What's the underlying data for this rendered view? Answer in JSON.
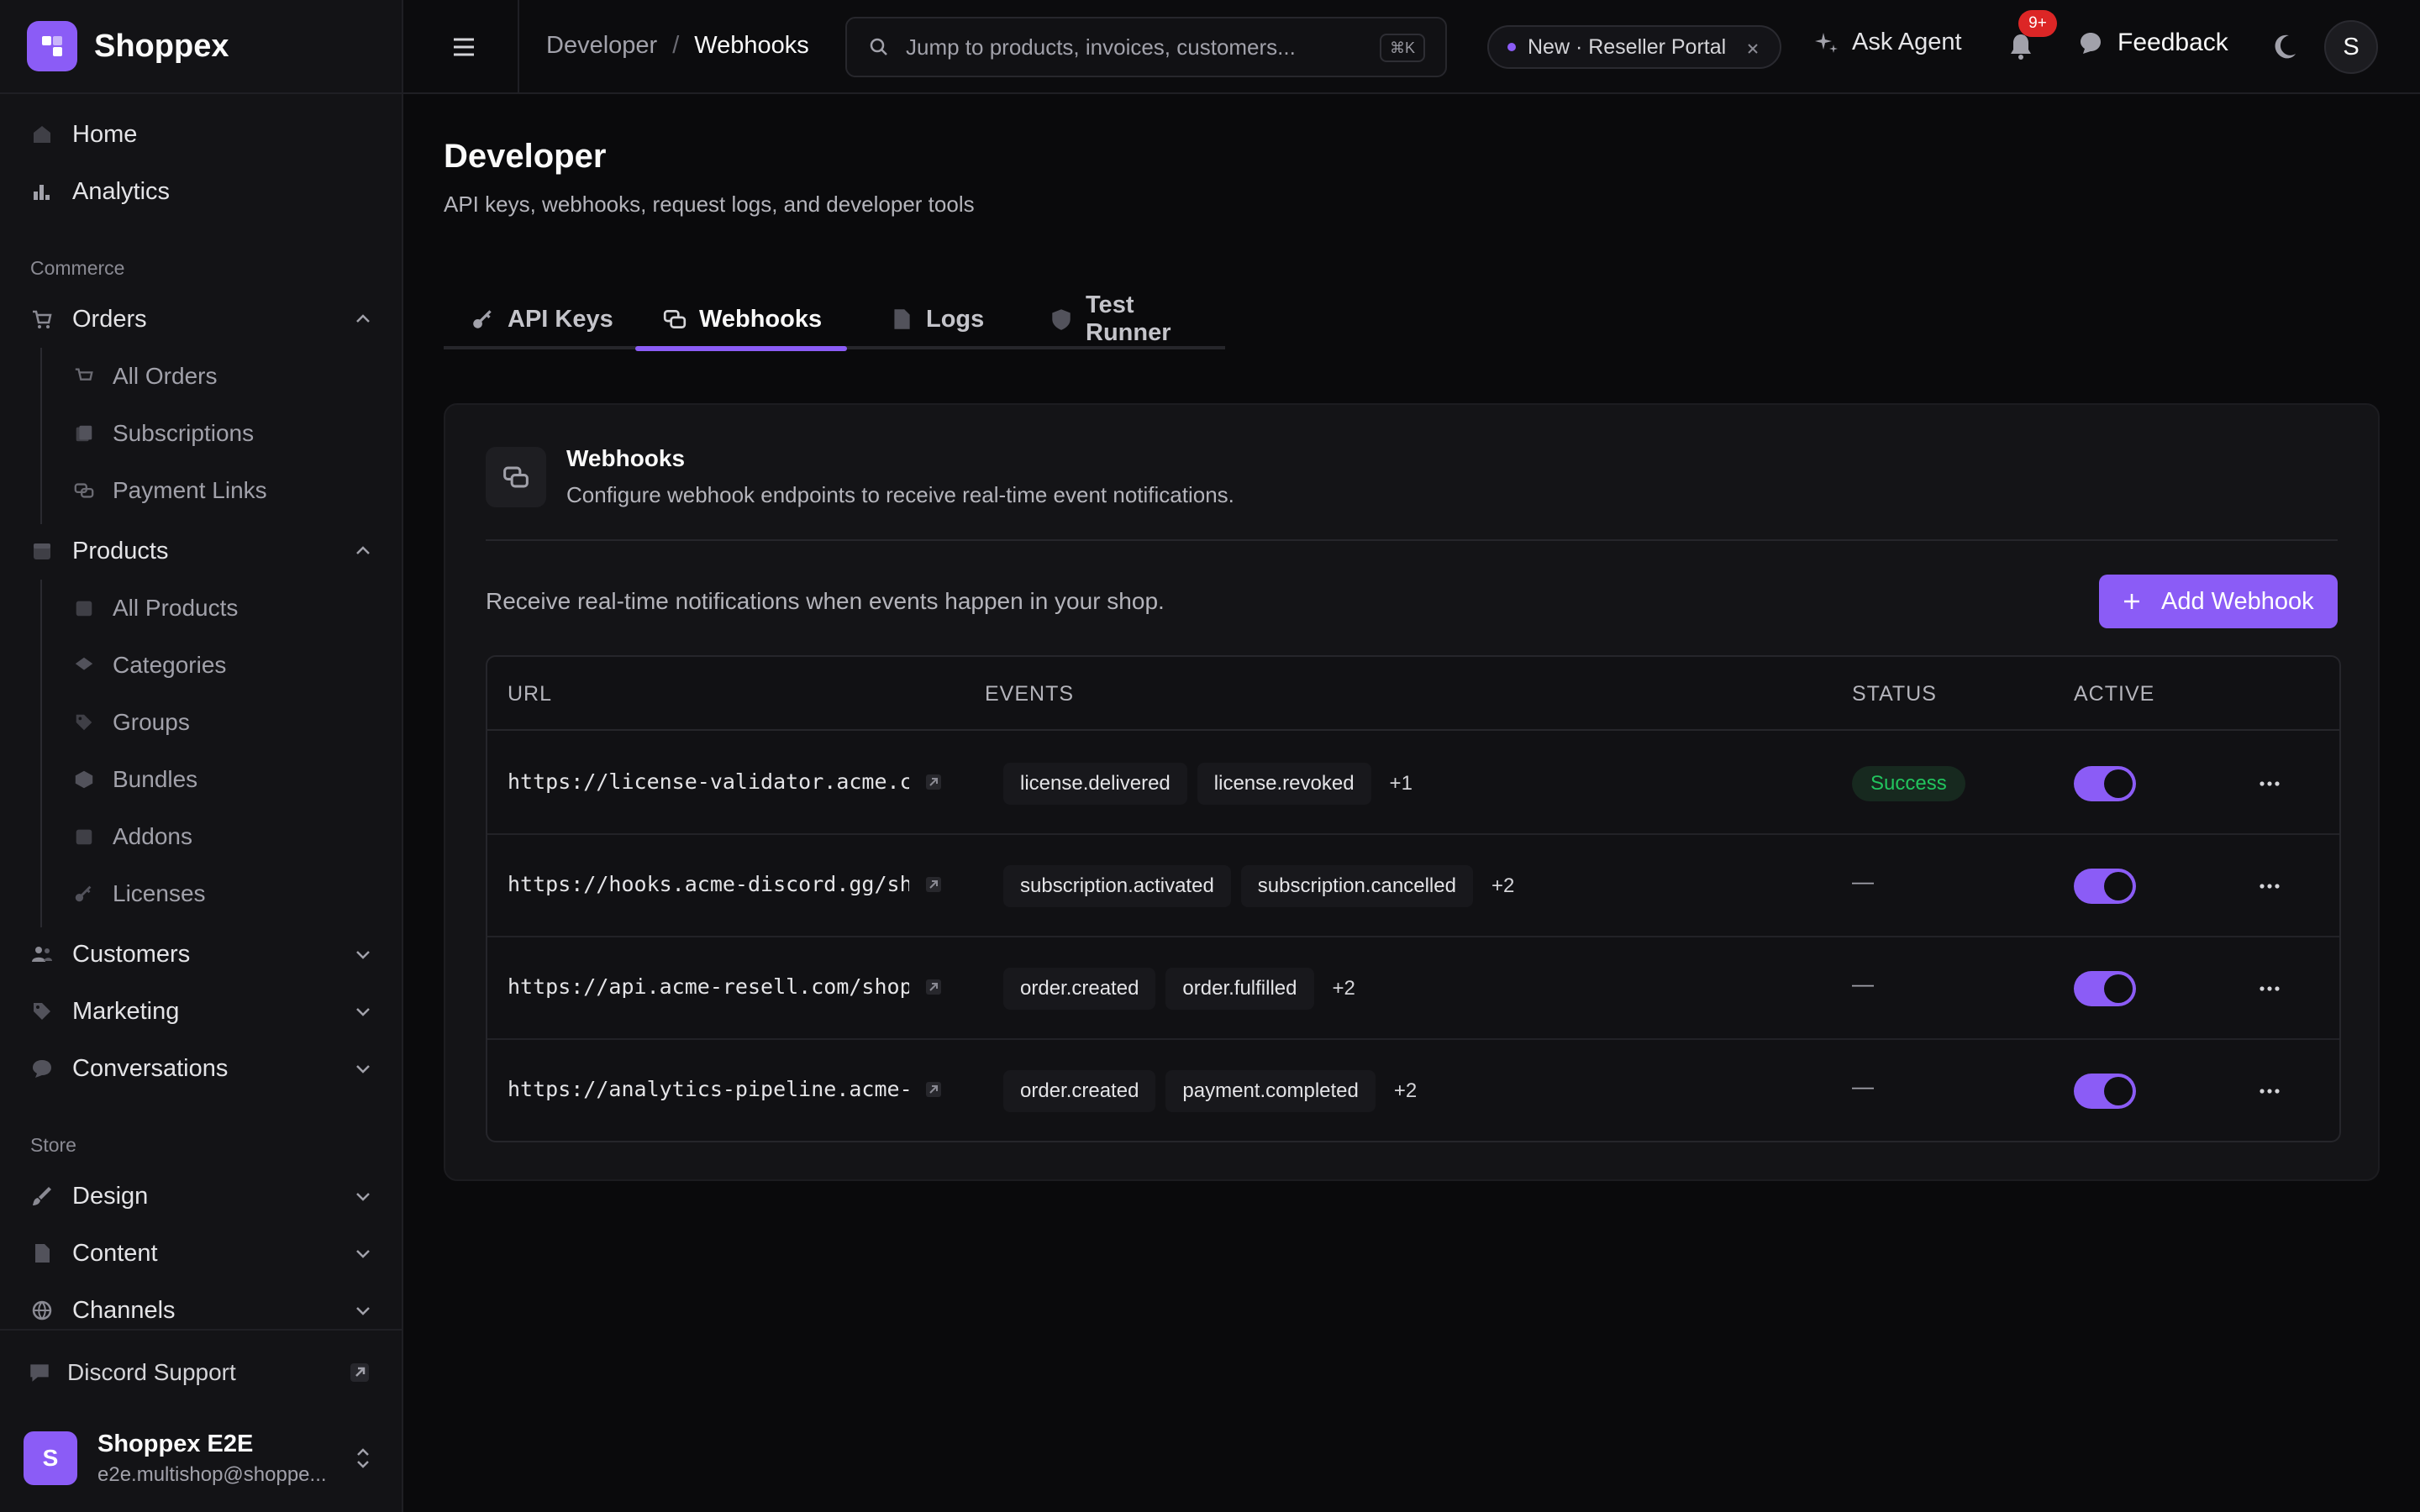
{
  "brand": {
    "name": "Shoppex"
  },
  "sidebar": {
    "top_items": [
      {
        "label": "Home",
        "icon": "home-icon"
      },
      {
        "label": "Analytics",
        "icon": "chart-icon"
      }
    ],
    "sections": {
      "commerce": "Commerce",
      "store": "Store"
    },
    "orders": {
      "label": "Orders",
      "children": [
        "All Orders",
        "Subscriptions",
        "Payment Links"
      ]
    },
    "products": {
      "label": "Products",
      "children": [
        "All Products",
        "Categories",
        "Groups",
        "Bundles",
        "Addons",
        "Licenses"
      ]
    },
    "collapsed": [
      "Customers",
      "Marketing",
      "Conversations"
    ],
    "store_items": [
      "Design",
      "Content",
      "Channels"
    ],
    "discord": "Discord Support",
    "account": {
      "initial": "S",
      "name": "Shoppex E2E",
      "email": "e2e.multishop@shoppe..."
    }
  },
  "topbar": {
    "breadcrumb": {
      "root": "Developer",
      "separator": "/",
      "current": "Webhooks"
    },
    "search": {
      "placeholder": "Jump to products, invoices, customers...",
      "shortcut": "⌘K"
    },
    "pill": "New · Reseller Portal",
    "ask_agent": "Ask Agent",
    "notifications_badge": "9+",
    "feedback": "Feedback",
    "user_initial": "S"
  },
  "page": {
    "title": "Developer",
    "subtitle": "API keys, webhooks, request logs, and developer tools"
  },
  "tabs": [
    {
      "label": "API Keys",
      "icon": "key-icon"
    },
    {
      "label": "Webhooks",
      "icon": "webhook-icon",
      "active": true
    },
    {
      "label": "Logs",
      "icon": "file-icon"
    },
    {
      "label": "Test Runner",
      "icon": "shield-icon"
    }
  ],
  "card": {
    "title": "Webhooks",
    "description": "Configure webhook endpoints to receive real-time event notifications.",
    "intro": "Receive real-time notifications when events happen in your shop.",
    "add_button": "Add Webhook"
  },
  "table": {
    "columns": {
      "url": "URL",
      "events": "EVENTS",
      "status": "STATUS",
      "active": "ACTIVE"
    },
    "rows": [
      {
        "url": "https://license-validator.acme.c…",
        "events": [
          "license.delivered",
          "license.revoked"
        ],
        "more": "+1",
        "status": "Success",
        "active": true
      },
      {
        "url": "https://hooks.acme-discord.gg/sh…",
        "events": [
          "subscription.activated",
          "subscription.cancelled"
        ],
        "more": "+2",
        "status": "—",
        "active": true
      },
      {
        "url": "https://api.acme-resell.com/shop…",
        "events": [
          "order.created",
          "order.fulfilled"
        ],
        "more": "+2",
        "status": "—",
        "active": true
      },
      {
        "url": "https://analytics-pipeline.acme-…",
        "events": [
          "order.created",
          "payment.completed"
        ],
        "more": "+2",
        "status": "—",
        "active": true
      }
    ]
  },
  "colors": {
    "accent": "#8b5cf6",
    "success": "#22c55e",
    "background": "#0a0a0c"
  }
}
